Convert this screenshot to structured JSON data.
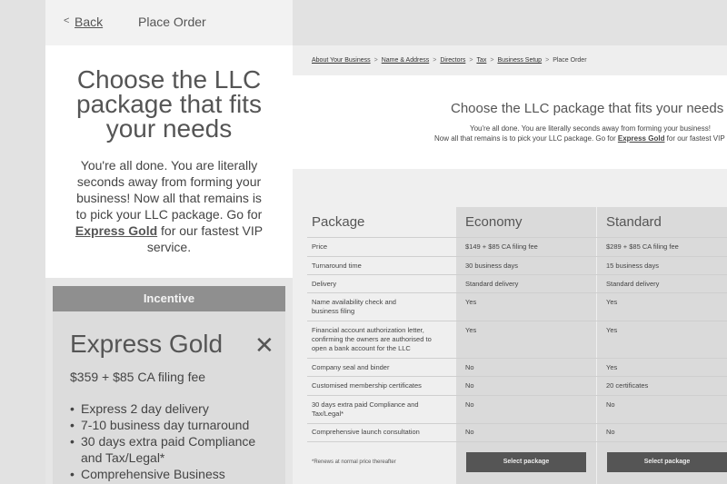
{
  "mobile": {
    "back_label": "Back",
    "title": "Place Order",
    "hero_title": "Choose the LLC package that fits your needs",
    "hero_text_before": "You're all done. You are literally seconds away from forming your business! Now all that remains is to pick your LLC package. Go for ",
    "hero_link": "Express Gold",
    "hero_text_after": " for our fastest VIP service.",
    "incentive_label": "Incentive",
    "card_title": "Express Gold",
    "card_price": "$359 + $85 CA filing fee",
    "card_items": [
      "Express 2 day delivery",
      "7-10 business day turnaround",
      "30 days extra paid Compliance and Tax/Legal*",
      "Comprehensive Business"
    ]
  },
  "desktop": {
    "breadcrumb": [
      "About Your Business",
      "Name & Address",
      "Directors",
      "Tax",
      "Business Setup"
    ],
    "breadcrumb_current": "Place Order",
    "hero_title": "Choose the LLC package that fits your needs",
    "hero_line1": "You're all done. You are literally seconds away from forming your business!",
    "hero_line2_before": "Now all that remains is to pick your LLC package. Go for ",
    "hero_link": "Express Gold",
    "hero_line2_after": " for our fastest VIP",
    "table": {
      "header_package": "Package",
      "header_economy": "Economy",
      "header_standard": "Standard",
      "rows": [
        {
          "label": "Price",
          "economy": "$149 + $85 CA filing fee",
          "standard": "$289 + $85 CA filing fee"
        },
        {
          "label": "Turnaround time",
          "economy": "30 business days",
          "standard": "15 business days"
        },
        {
          "label": "Delivery",
          "economy": "Standard delivery",
          "standard": "Standard delivery"
        },
        {
          "label": "Name availability check and business filing",
          "economy": "Yes",
          "standard": "Yes"
        },
        {
          "label": "Financial account authorization letter, confirming the owners are authorised to open a bank account for the LLC",
          "economy": "Yes",
          "standard": "Yes"
        },
        {
          "label": "Company seal and binder",
          "economy": "No",
          "standard": "Yes"
        },
        {
          "label": "Customised membership certificates",
          "economy": "No",
          "standard": "20 certificates"
        },
        {
          "label": "30 days extra paid Compliance and Tax/Legal*",
          "economy": "No",
          "standard": "No"
        },
        {
          "label": "Comprehensive launch consultation",
          "economy": "No",
          "standard": "No"
        }
      ],
      "footnote": "*Renews at normal price thereafter",
      "select_economy": "Select package",
      "select_standard": "Select package"
    }
  }
}
